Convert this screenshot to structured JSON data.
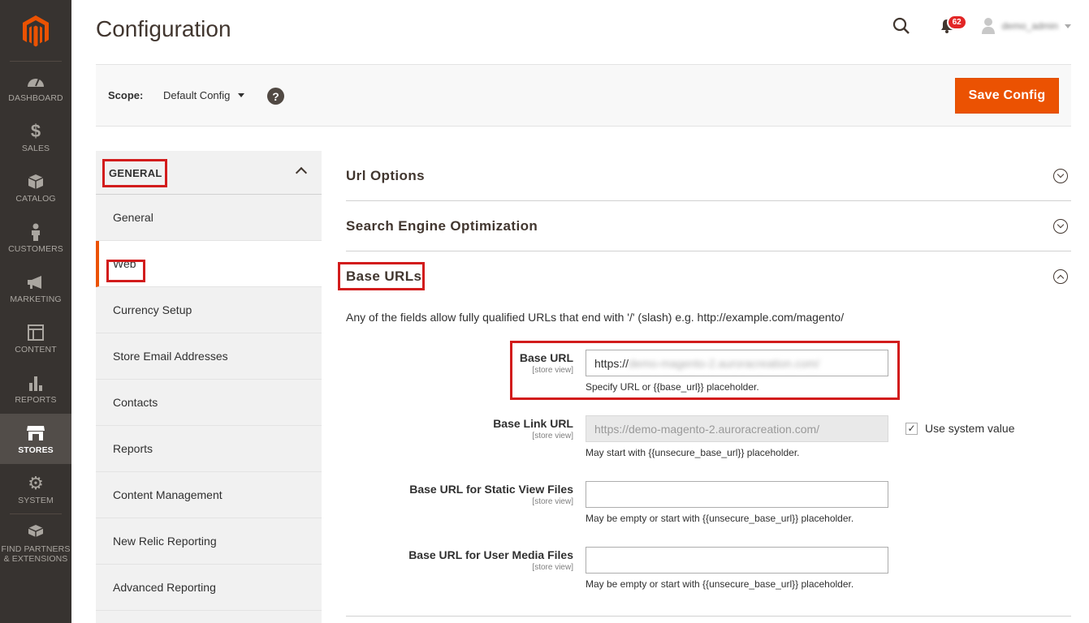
{
  "brand": {
    "accent": "#eb5202",
    "menu_bg": "#373330",
    "highlight": "#d21c1c"
  },
  "admin_menu": {
    "items": [
      {
        "label": "DASHBOARD",
        "icon": "dashboard-icon"
      },
      {
        "label": "SALES",
        "icon": "dollar-icon"
      },
      {
        "label": "CATALOG",
        "icon": "cube-icon"
      },
      {
        "label": "CUSTOMERS",
        "icon": "person-icon"
      },
      {
        "label": "MARKETING",
        "icon": "megaphone-icon"
      },
      {
        "label": "CONTENT",
        "icon": "layout-icon"
      },
      {
        "label": "REPORTS",
        "icon": "bar-chart-icon"
      },
      {
        "label": "STORES",
        "icon": "store-icon",
        "active": true
      },
      {
        "label": "SYSTEM",
        "icon": "gear-icon"
      },
      {
        "label": "FIND PARTNERS & EXTENSIONS",
        "icon": "boxes-icon"
      }
    ]
  },
  "header": {
    "title": "Configuration",
    "notification_count": "62",
    "user_name": "demo_admin"
  },
  "scope": {
    "label": "Scope:",
    "value": "Default Config",
    "help": "?",
    "save_label": "Save Config"
  },
  "config_nav": {
    "group_label": "GENERAL",
    "items": [
      {
        "label": "General"
      },
      {
        "label": "Web",
        "active": true
      },
      {
        "label": "Currency Setup"
      },
      {
        "label": "Store Email Addresses"
      },
      {
        "label": "Contacts"
      },
      {
        "label": "Reports"
      },
      {
        "label": "Content Management"
      },
      {
        "label": "New Relic Reporting"
      },
      {
        "label": "Advanced Reporting"
      }
    ]
  },
  "sections": {
    "url_options": "Url Options",
    "seo": "Search Engine Optimization",
    "base_urls": "Base URLs"
  },
  "base_urls": {
    "intro": "Any of the fields allow fully qualified URLs that end with '/' (slash) e.g. http://example.com/magento/",
    "fields": [
      {
        "label": "Base URL",
        "scope": "[store view]",
        "value_prefix": "https://",
        "value_blurred": "demo-magento-2.auroracreation.com/",
        "note": "Specify URL or {{base_url}} placeholder."
      },
      {
        "label": "Base Link URL",
        "scope": "[store view]",
        "value": "https://demo-magento-2.auroracreation.com/",
        "note": "May start with {{unsecure_base_url}} placeholder.",
        "use_system_value_label": "Use system value",
        "use_system_value": true
      },
      {
        "label": "Base URL for Static View Files",
        "scope": "[store view]",
        "value": "",
        "note": "May be empty or start with {{unsecure_base_url}} placeholder."
      },
      {
        "label": "Base URL for User Media Files",
        "scope": "[store view]",
        "value": "",
        "note": "May be empty or start with {{unsecure_base_url}} placeholder."
      }
    ]
  }
}
